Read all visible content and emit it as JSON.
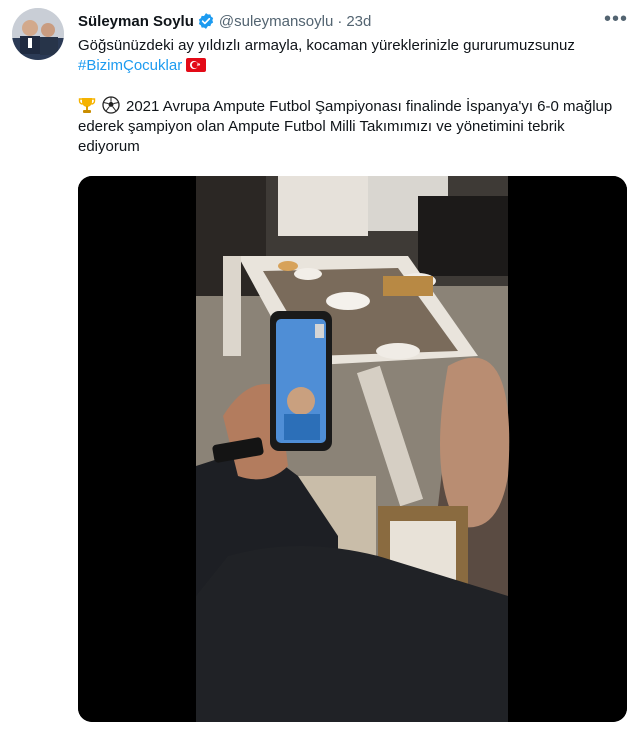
{
  "author": {
    "name": "Süleyman Soylu",
    "handle": "@suleymansoylu",
    "time": "23d",
    "verified": true
  },
  "tweet": {
    "line1": "Göğsünüzdeki ay yıldızlı armayla, kocaman yüreklerinizle gururumuzsunuz",
    "hashtag": "#BizimÇocuklar",
    "flag_icon": "turkey-flag-icon",
    "paragraph2": "2021 Avrupa Ampute Futbol Şampiyonası finalinde İspanya'yı 6-0 mağlup ederek şampiyon olan Ampute Futbol Milli Takımımızı ve yönetimini tebrik ediyorum",
    "emoji_icons": [
      "trophy-icon",
      "soccer-ball-icon"
    ]
  },
  "colors": {
    "link": "#1d9bf0",
    "secondary_text": "#536471",
    "verified_badge": "#1d9bf0",
    "flag_red": "#e30a17"
  },
  "actions": {
    "more_icon": "more-icon"
  }
}
